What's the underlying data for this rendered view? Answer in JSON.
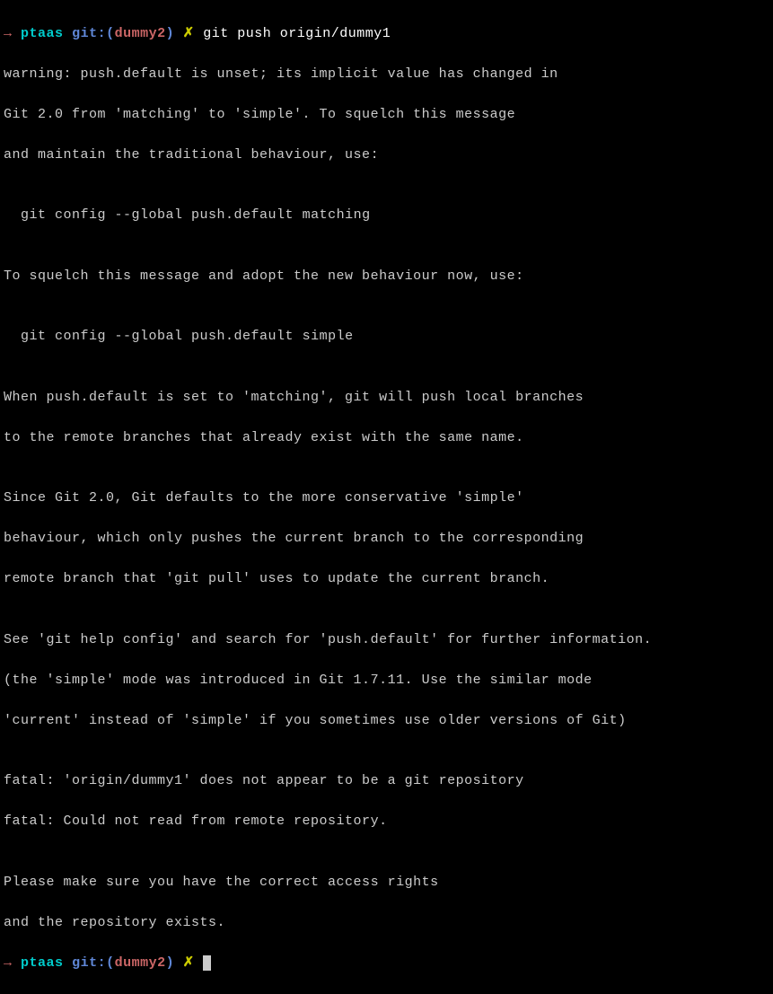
{
  "prompt1": {
    "arrow": "→",
    "dir": "ptaas",
    "git_label": "git:(",
    "branch": "dummy2",
    "git_close": ")",
    "x": "✗",
    "command": "git push origin/dummy1"
  },
  "output_lines": [
    "warning: push.default is unset; its implicit value has changed in",
    "Git 2.0 from 'matching' to 'simple'. To squelch this message",
    "and maintain the traditional behaviour, use:",
    "",
    "  git config --global push.default matching",
    "",
    "To squelch this message and adopt the new behaviour now, use:",
    "",
    "  git config --global push.default simple",
    "",
    "When push.default is set to 'matching', git will push local branches",
    "to the remote branches that already exist with the same name.",
    "",
    "Since Git 2.0, Git defaults to the more conservative 'simple'",
    "behaviour, which only pushes the current branch to the corresponding",
    "remote branch that 'git pull' uses to update the current branch.",
    "",
    "See 'git help config' and search for 'push.default' for further information.",
    "(the 'simple' mode was introduced in Git 1.7.11. Use the similar mode",
    "'current' instead of 'simple' if you sometimes use older versions of Git)",
    "",
    "fatal: 'origin/dummy1' does not appear to be a git repository",
    "fatal: Could not read from remote repository.",
    "",
    "Please make sure you have the correct access rights",
    "and the repository exists."
  ],
  "prompt2": {
    "arrow": "→",
    "dir": "ptaas",
    "git_label": "git:(",
    "branch": "dummy2",
    "git_close": ")",
    "x": "✗"
  }
}
